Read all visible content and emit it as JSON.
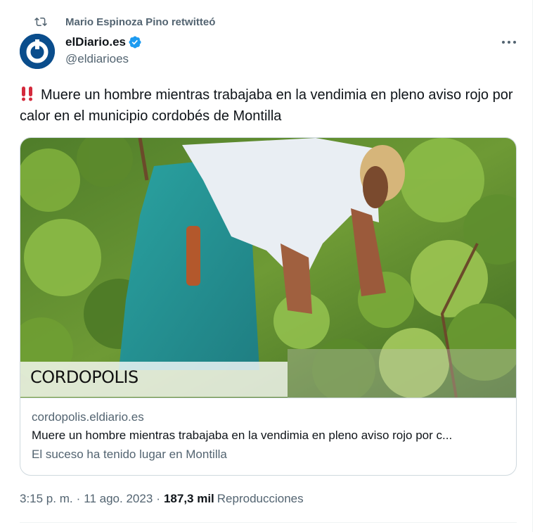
{
  "retweet": {
    "text": "Mario Espinoza Pino retwitteó",
    "icon": "retweet-icon"
  },
  "author": {
    "name": "elDiario.es",
    "handle": "@eldiarioes",
    "verified": true,
    "avatar_icon": "eldiario-logo",
    "brand_color": "#0a4d8c"
  },
  "tweet": {
    "emoji_icon": "double-exclamation-icon",
    "text": "Muere un hombre mientras trabajaba en la vendimia en pleno aviso rojo por calor en el municipio cordobés de Montilla"
  },
  "card": {
    "image_logo": "CORDOPOLIS",
    "domain": "cordopolis.eldiario.es",
    "title": "Muere un hombre mientras trabajaba en la vendimia en pleno aviso rojo por c...",
    "description": "El suceso ha tenido lugar en Montilla"
  },
  "meta": {
    "time": "3:15 p. m.",
    "date": "11 ago. 2023",
    "separator": "·",
    "views_count": "187,3 mil",
    "views_label": "Reproducciones"
  },
  "colors": {
    "text_primary": "#0f1419",
    "text_secondary": "#536471",
    "verified_blue": "#1d9bf0",
    "border": "#cfd9de",
    "alert_red": "#d42a3c"
  }
}
